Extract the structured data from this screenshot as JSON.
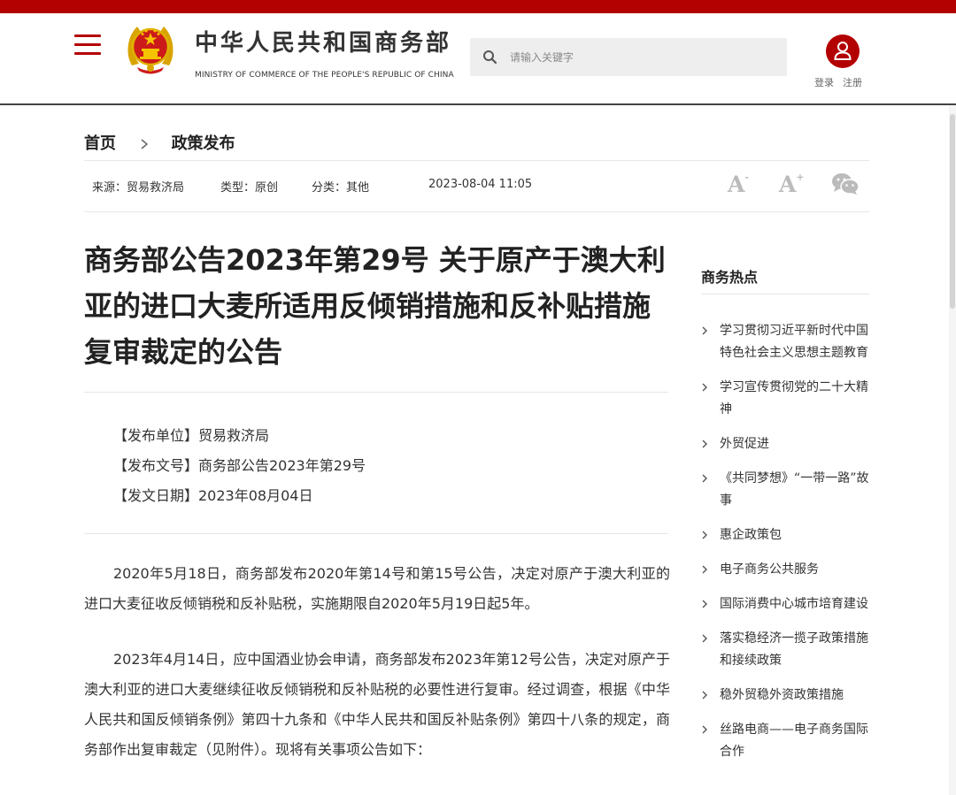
{
  "header": {
    "title": "中华人民共和国商务部",
    "subtitle": "MINISTRY OF COMMERCE OF THE PEOPLE'S REPUBLIC OF CHINA",
    "search_placeholder": "请输入关键字",
    "login": "登录",
    "register": "注册"
  },
  "breadcrumb": {
    "home": "首页",
    "current": "政策发布"
  },
  "meta": {
    "source": "来源：贸易救济局",
    "type": "类型：原创",
    "category": "分类：其他",
    "datetime": "2023-08-04 11:05"
  },
  "tools": {
    "font_small": "A",
    "font_small_sign": "-",
    "font_large": "A",
    "font_large_sign": "+"
  },
  "article": {
    "title": "商务部公告2023年第29号 关于原产于澳大利亚的进口大麦所适用反倾销措施和反补贴措施复审裁定的公告",
    "issuer": "【发布单位】贸易救济局",
    "doc_no": "【发布文号】商务部公告2023年第29号",
    "date": "【发文日期】2023年08月04日",
    "paragraphs": [
      "2020年5月18日，商务部发布2020年第14号和第15号公告，决定对原产于澳大利亚的进口大麦征收反倾销税和反补贴税，实施期限自2020年5月19日起5年。",
      "2023年4月14日，应中国酒业协会申请，商务部发布2023年第12号公告，决定对原产于澳大利亚的进口大麦继续征收反倾销税和反补贴税的必要性进行复审。经过调查，根据《中华人民共和国反倾销条例》第四十九条和《中华人民共和国反补贴条例》第四十八条的规定，商务部作出复审裁定（见附件）。现将有关事项公告如下："
    ]
  },
  "sidebar": {
    "title": "商务热点",
    "items": [
      "学习贯彻习近平新时代中国特色社会主义思想主题教育",
      "学习宣传贯彻党的二十大精神",
      "外贸促进",
      "《共同梦想》“一带一路”故事",
      "惠企政策包",
      "电子商务公共服务",
      "国际消费中心城市培育建设",
      "落实稳经济一揽子政策措施和接续政策",
      "稳外贸稳外资政策措施",
      "丝路电商——电子商务国际合作"
    ]
  },
  "colors": {
    "brand": "#b30000",
    "text": "#333333",
    "divider": "#e6e6e6"
  }
}
